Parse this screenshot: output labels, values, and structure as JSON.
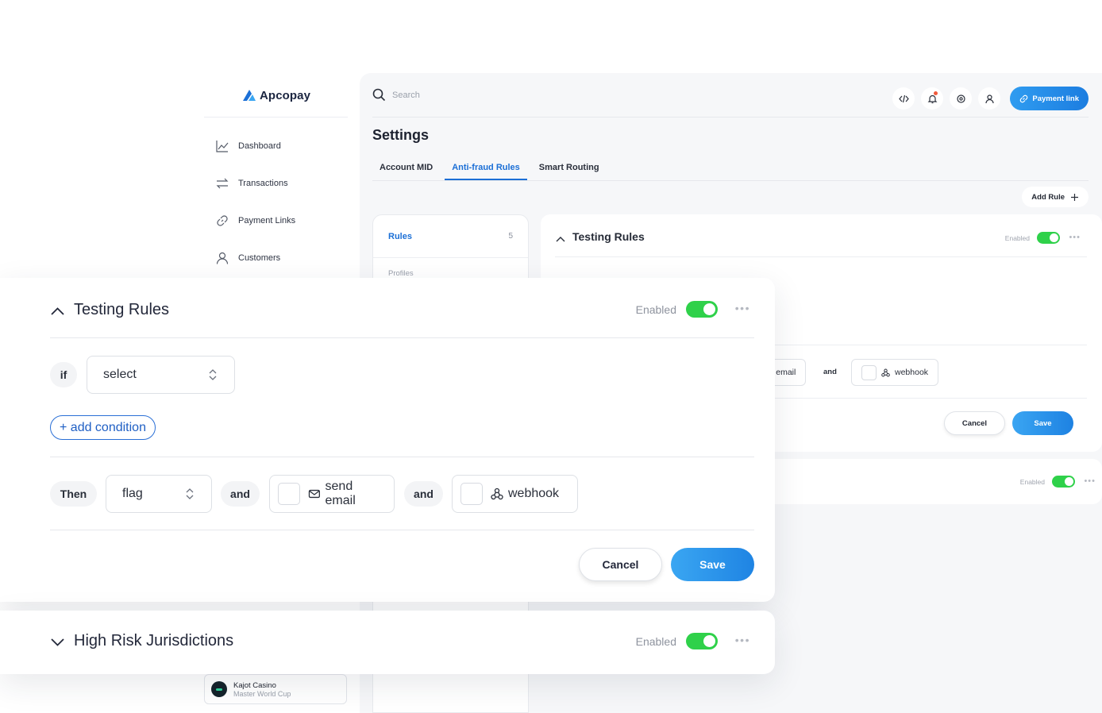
{
  "brand": {
    "name": "Apcopay",
    "accent": "#1b6fd6",
    "toggle_on": "#2fd14a"
  },
  "sidebar": {
    "items": [
      {
        "label": "Dashboard",
        "icon": "chart-line-icon"
      },
      {
        "label": "Transactions",
        "icon": "arrows-exchange-icon"
      },
      {
        "label": "Payment Links",
        "icon": "link-icon"
      },
      {
        "label": "Customers",
        "icon": "user-icon"
      }
    ],
    "merchant": {
      "name": "Kajot Casino",
      "subtitle": "Master World Cup"
    }
  },
  "topbar": {
    "search_placeholder": "Search",
    "icons": [
      "code-icon",
      "bell-icon",
      "target-icon",
      "user-icon"
    ],
    "payment_link_label": "Payment link"
  },
  "page": {
    "title": "Settings",
    "tabs": [
      {
        "label": "Account MID",
        "active": false
      },
      {
        "label": "Anti-fraud Rules",
        "active": true
      },
      {
        "label": "Smart Routing",
        "active": false
      }
    ],
    "add_rule_label": "Add Rule"
  },
  "rules_panel": {
    "rules_label": "Rules",
    "rules_count": "5",
    "profiles_label": "Profiles"
  },
  "background_card": {
    "title": "Testing Rules",
    "enabled_label": "Enabled",
    "send_email_partial": "l email",
    "and_label": "and",
    "webhook_label": "webhook",
    "cancel_label": "Cancel",
    "save_label": "Save"
  },
  "background_card2": {
    "enabled_label": "Enabled"
  },
  "rule_card": {
    "title": "Testing Rules",
    "enabled_label": "Enabled",
    "enabled": true,
    "if_label": "if",
    "condition_select": "select",
    "add_condition_label": "+ add condition",
    "then_label": "Then",
    "action_select": "flag",
    "and_label": "and",
    "send_email_label": "send email",
    "webhook_label": "webhook",
    "cancel_label": "Cancel",
    "save_label": "Save"
  },
  "collapsed_card": {
    "title": "High Risk Jurisdictions",
    "enabled_label": "Enabled",
    "enabled": true
  }
}
